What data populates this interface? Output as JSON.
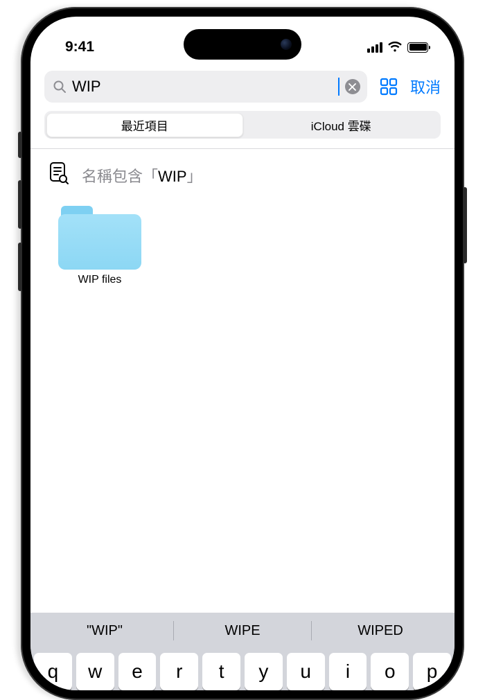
{
  "status": {
    "time": "9:41"
  },
  "search": {
    "value": "WIP"
  },
  "actions": {
    "cancel": "取消"
  },
  "tabs": {
    "recent": "最近項目",
    "icloud": "iCloud 雲碟"
  },
  "filter": {
    "prefix": "名稱包含",
    "open": "「",
    "term": "WIP",
    "close": "」"
  },
  "results": [
    {
      "name": "WIP files"
    }
  ],
  "suggestions": [
    "\"WIP\"",
    "WIPE",
    "WIPED"
  ],
  "keyboard_row1": [
    "q",
    "w",
    "e",
    "r",
    "t",
    "y",
    "u",
    "i",
    "o",
    "p"
  ]
}
